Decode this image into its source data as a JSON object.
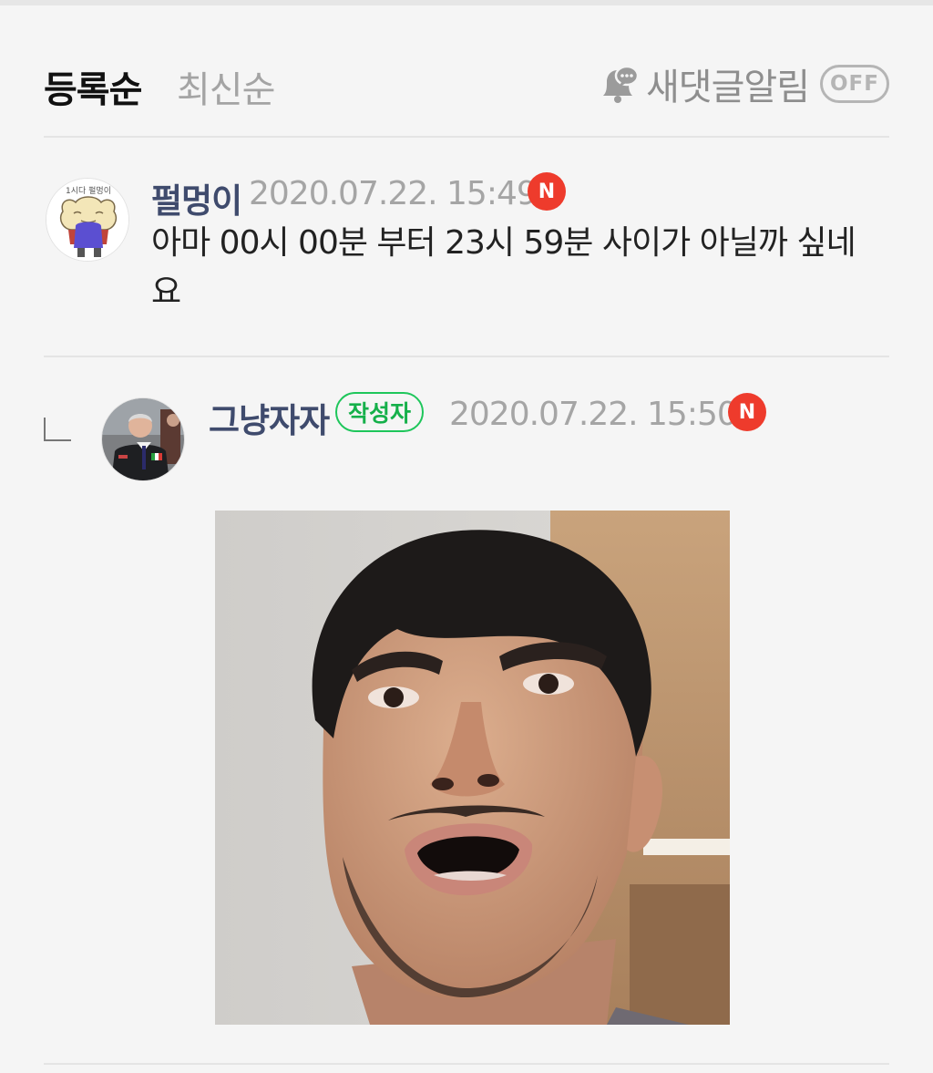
{
  "sort": {
    "active": "등록순",
    "inactive": "최신순"
  },
  "notify": {
    "label": "새댓글알림",
    "toggle": "OFF",
    "icon": "bell-chat-icon"
  },
  "comments": [
    {
      "author": "펄멍이",
      "date": "2020.07.22. 15:49",
      "new_badge": "N",
      "text": "아마 00시 00분 부터 23시 59분 사이가 아닐까 싶네요",
      "avatar_caption": "1시다 펄멍이"
    },
    {
      "author": "그냥자자",
      "writer_badge": "작성자",
      "date": "2020.07.22. 15:50",
      "new_badge": "N",
      "is_reply": true
    }
  ],
  "colors": {
    "author": "#3f4b6d",
    "new_badge": "#ee3b2c",
    "writer_badge": "#15b04a",
    "muted": "#a5a5a5"
  }
}
